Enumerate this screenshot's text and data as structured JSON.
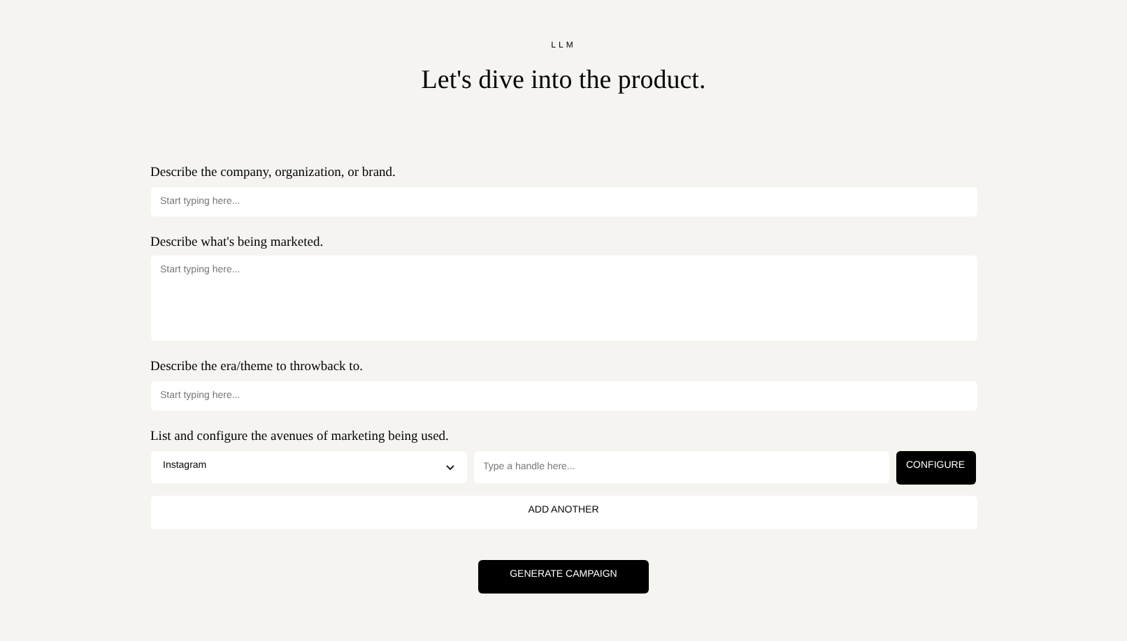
{
  "eyebrow": "LLM",
  "heading": "Let's dive into the product.",
  "fields": [
    {
      "kind": "text",
      "label": "Describe the company, organization, or brand.",
      "placeholder": "Start typing here..."
    },
    {
      "kind": "textarea",
      "label": "Describe what's being marketed.",
      "placeholder": "Start typing here..."
    },
    {
      "kind": "text",
      "label": "Describe the era/theme to throwback to.",
      "placeholder": "Start typing here..."
    }
  ],
  "avenues": {
    "label": "List and configure the avenues of marketing being used.",
    "channel": "Instagram",
    "handle_placeholder": "Type a handle here...",
    "configure": "CONFIGURE",
    "add": "ADD ANOTHER"
  },
  "submit": "GENERATE CAMPAIGN"
}
